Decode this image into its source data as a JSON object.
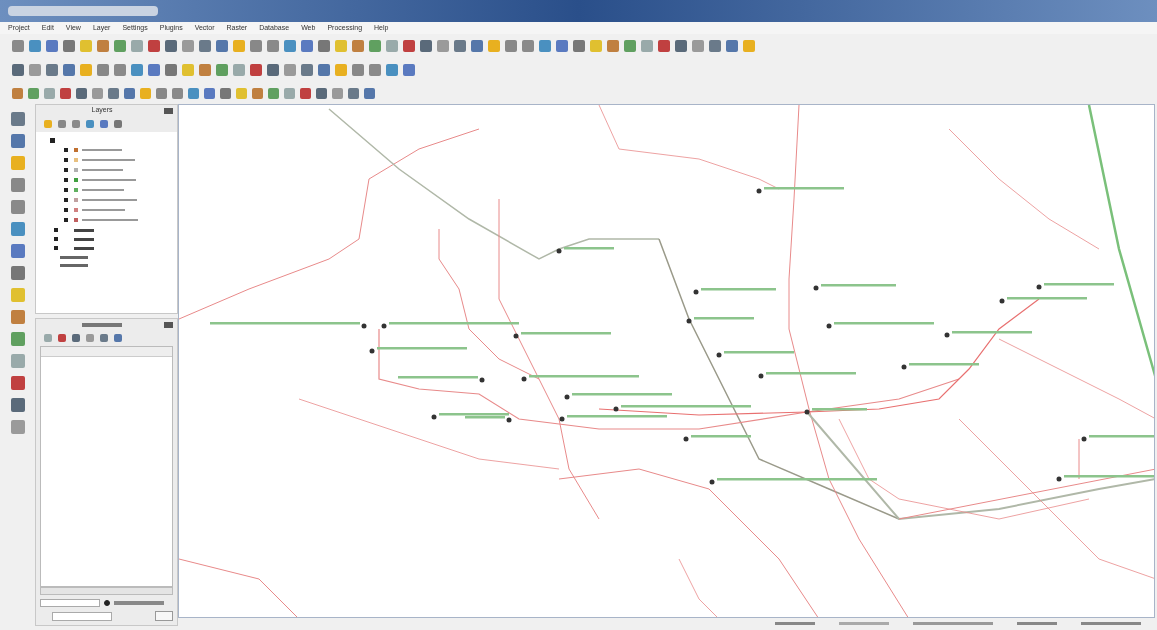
{
  "menu_bar": {
    "items": [
      "Project",
      "Edit",
      "View",
      "Layer",
      "Settings",
      "Plugins",
      "Vector",
      "Raster",
      "Database",
      "Web",
      "Processing",
      "Help"
    ]
  },
  "layers_panel": {
    "title": "Layers"
  },
  "results_panel": {
    "option": {
      "selected": true
    }
  }
}
